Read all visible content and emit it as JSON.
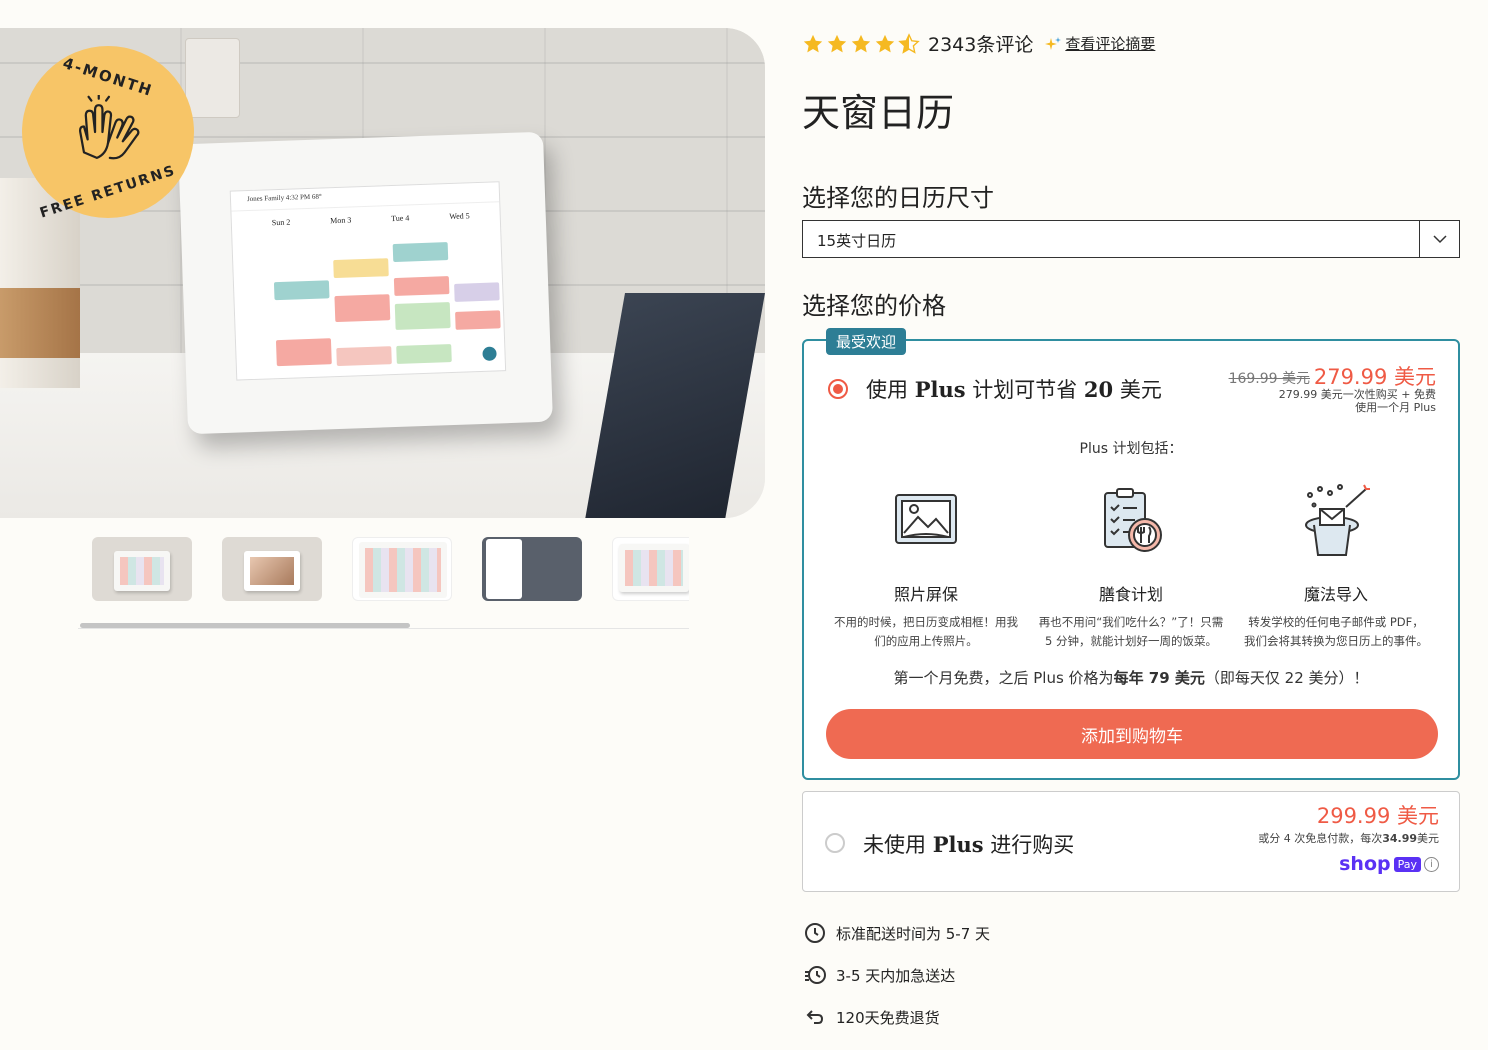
{
  "gallery": {
    "badge_top": "4-MONTH",
    "badge_bottom": "FREE RETURNS",
    "screen_title": "Jones Family",
    "screen_time": "4:32 PM",
    "screen_temp": "68°",
    "screen_days": [
      "Sun 2",
      "Mon 3",
      "Tue 4",
      "Wed 5"
    ],
    "thumbnail_count": 5
  },
  "rating": {
    "stars": 4.5,
    "count_text": "2343条评论",
    "summary_link": "查看评论摘要"
  },
  "product": {
    "title": "天窗日历"
  },
  "size": {
    "label": "选择您的日历尺寸",
    "selected": "15英寸日历"
  },
  "price_section": {
    "label": "选择您的价格"
  },
  "plan_plus": {
    "tag": "最受欢迎",
    "name_prefix": "使用 ",
    "name_bold": "Plus",
    "name_mid": " 计划可节省 ",
    "name_bold2": "20",
    "name_suffix": " 美元",
    "price_old": "169.99 美元",
    "price_new": "279.99 美元",
    "price_note_line1": "279.99 美元一次性购买 + 免费",
    "price_note_line2": "使用一个月 Plus",
    "includes_label": "Plus 计划包括：",
    "features": [
      {
        "icon": "photo-frame-icon",
        "name": "照片屏保",
        "desc_line1": "不用的时候，把日历变成相框！用我",
        "desc_line2": "们的应用上传照片。"
      },
      {
        "icon": "meal-plan-icon",
        "name": "膳食计划",
        "desc_line1": "再也不用问“我们吃什么？”了！只需",
        "desc_line2": "5 分钟，就能计划好一周的饭菜。"
      },
      {
        "icon": "magic-hat-icon",
        "name": "魔法导入",
        "desc_line1": "转发学校的任何电子邮件或 PDF，",
        "desc_line2": "我们会将其转换为您日历上的事件。"
      }
    ],
    "footnote_pre": "第一个月免费，之后 Plus 价格为",
    "footnote_bold": "每年 79 美元",
    "footnote_post": "（即每天仅 22 美分）！",
    "cart_button": "添加到购物车",
    "accent": "#2f8ea0",
    "button_color": "#ef6a52"
  },
  "plan_basic": {
    "name_prefix": "未使用 ",
    "name_bold": "Plus",
    "name_suffix": " 进行购买",
    "price": "299.99 美元",
    "note_pre": "或分 4 次免息付款，每次",
    "note_bold": "34.99",
    "note_post": "美元",
    "shop_word": "shop",
    "shop_pay": "Pay",
    "info": "i"
  },
  "shipping": [
    {
      "icon": "clock-icon",
      "text": "标准配送时间为 5-7 天"
    },
    {
      "icon": "fast-clock-icon",
      "text": "3-5 天内加急送达"
    },
    {
      "icon": "return-arrow-icon",
      "text": "120天免费退货"
    }
  ]
}
